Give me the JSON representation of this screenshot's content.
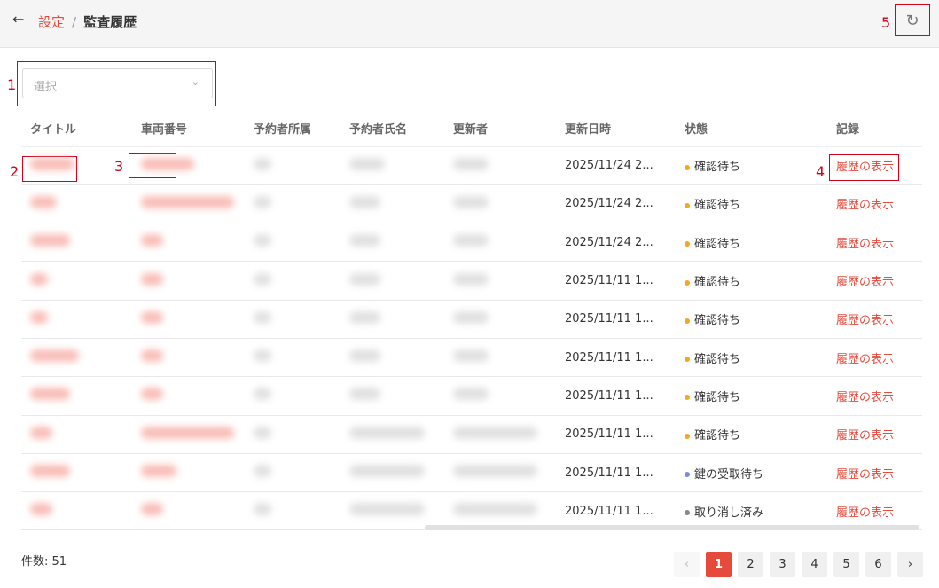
{
  "header": {
    "back_icon": "arrow-left-icon",
    "breadcrumb_link": "設定",
    "breadcrumb_sep": "/",
    "breadcrumb_current": "監査履歴",
    "refresh_icon": "refresh-icon"
  },
  "annotations": [
    "1",
    "2",
    "3",
    "4",
    "5"
  ],
  "filter": {
    "placeholder": "選択"
  },
  "table": {
    "columns": [
      "タイトル",
      "車両番号",
      "予約者所属",
      "予約者氏名",
      "更新者",
      "更新日時",
      "状態",
      "記録"
    ],
    "rows": [
      {
        "updated": "2025/11/24 2...",
        "status": "確認待ち",
        "status_color": "#f5a623",
        "record": "履歴の表示"
      },
      {
        "updated": "2025/11/24 2...",
        "status": "確認待ち",
        "status_color": "#f5a623",
        "record": "履歴の表示"
      },
      {
        "updated": "2025/11/24 2...",
        "status": "確認待ち",
        "status_color": "#f5a623",
        "record": "履歴の表示"
      },
      {
        "updated": "2025/11/11 1...",
        "status": "確認待ち",
        "status_color": "#f5a623",
        "record": "履歴の表示"
      },
      {
        "updated": "2025/11/11 1...",
        "status": "確認待ち",
        "status_color": "#f5a623",
        "record": "履歴の表示"
      },
      {
        "updated": "2025/11/11 1...",
        "status": "確認待ち",
        "status_color": "#f5a623",
        "record": "履歴の表示"
      },
      {
        "updated": "2025/11/11 1...",
        "status": "確認待ち",
        "status_color": "#f5a623",
        "record": "履歴の表示"
      },
      {
        "updated": "2025/11/11 1...",
        "status": "確認待ち",
        "status_color": "#f5a623",
        "record": "履歴の表示"
      },
      {
        "updated": "2025/11/11 1...",
        "status": "鍵の受取待ち",
        "status_color": "#7b8ce0",
        "record": "履歴の表示"
      },
      {
        "updated": "2025/11/11 1...",
        "status": "取り消し済み",
        "status_color": "#888888",
        "record": "履歴の表示"
      }
    ]
  },
  "footer": {
    "count": "件数: 51",
    "pages": [
      "‹",
      "1",
      "2",
      "3",
      "4",
      "5",
      "6",
      "›"
    ],
    "active_page": "1"
  }
}
